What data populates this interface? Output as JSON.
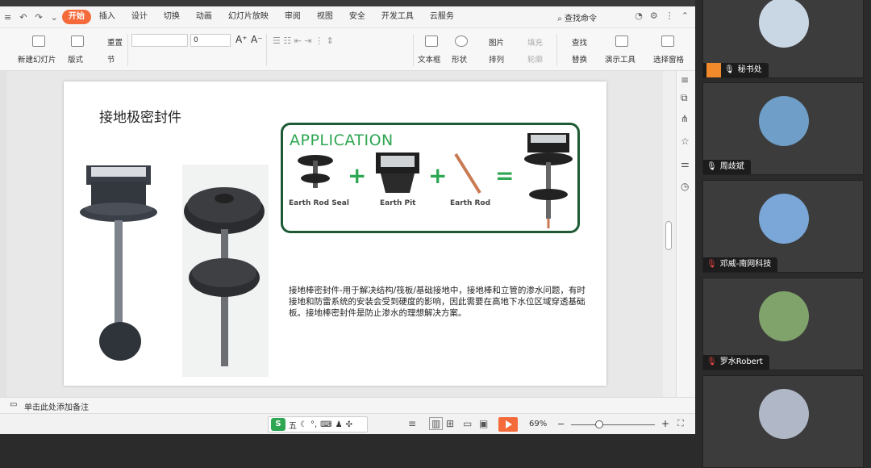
{
  "menu": {
    "tabs": [
      "开始",
      "插入",
      "设计",
      "切换",
      "动画",
      "幻灯片放映",
      "审阅",
      "视图",
      "安全",
      "开发工具",
      "云服务"
    ],
    "search": "查找命令"
  },
  "ribbon": {
    "new_slide": "新建幻灯片",
    "layout": "版式",
    "reset": "重置",
    "section": "节",
    "font_size": "0",
    "textbox": "文本框",
    "shape": "形状",
    "picture": "图片",
    "arrange": "排列",
    "fill": "填充",
    "outline": "轮廓",
    "find": "查找",
    "replace": "替换",
    "present_tools": "演示工具",
    "select_pane": "选择窗格"
  },
  "slide": {
    "title": "接地极密封件",
    "application_title": "APPLICATION",
    "labels": [
      "Earth Rod Seal",
      "Earth Pit",
      "Earth Rod"
    ],
    "description": "接地棒密封件-用于解决结构/筏板/基础接地中，接地棒和立管的渗水问题，有时接地和防雷系统的安装会受到硬度的影响，因此需要在高地下水位区域穿透基础板。接地棒密封件是防止渗水的理想解决方案。"
  },
  "notes": {
    "placeholder": "单击此处添加备注"
  },
  "status": {
    "ime_label": "五",
    "zoom": "69%"
  },
  "participants": [
    {
      "name": "秘书处",
      "color": "#c9d6e3"
    },
    {
      "name": "周歧斌",
      "color": "#6f9ec8"
    },
    {
      "name": "邓威-南网科技",
      "color": "#7aa7d8"
    },
    {
      "name": "罗水Robert",
      "color": "#7fa36a"
    },
    {
      "name": "",
      "color": "#b0b8c8"
    }
  ]
}
